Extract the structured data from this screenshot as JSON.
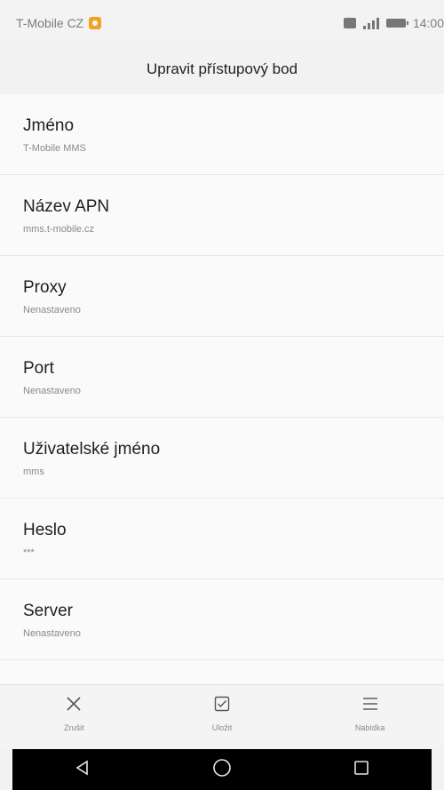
{
  "status_bar": {
    "carrier": "T-Mobile CZ",
    "time": "14:00"
  },
  "header": {
    "title": "Upravit přístupový bod"
  },
  "apn_fields": [
    {
      "label": "Jméno",
      "value": "T-Mobile MMS"
    },
    {
      "label": "Název APN",
      "value": "mms.t-mobile.cz"
    },
    {
      "label": "Proxy",
      "value": "Nenastaveno"
    },
    {
      "label": "Port",
      "value": "Nenastaveno"
    },
    {
      "label": "Uživatelské jméno",
      "value": "mms"
    },
    {
      "label": "Heslo",
      "value": "***"
    },
    {
      "label": "Server",
      "value": "Nenastaveno"
    }
  ],
  "action_bar": {
    "cancel": {
      "label": "Zrušit",
      "icon": "close-icon"
    },
    "save": {
      "label": "Uložit",
      "icon": "checkbox-icon"
    },
    "menu": {
      "label": "Nabídka",
      "icon": "menu-icon"
    }
  },
  "nav_bar": {
    "back_icon": "back-triangle-icon",
    "home_icon": "home-circle-icon",
    "recents_icon": "recents-square-icon"
  }
}
